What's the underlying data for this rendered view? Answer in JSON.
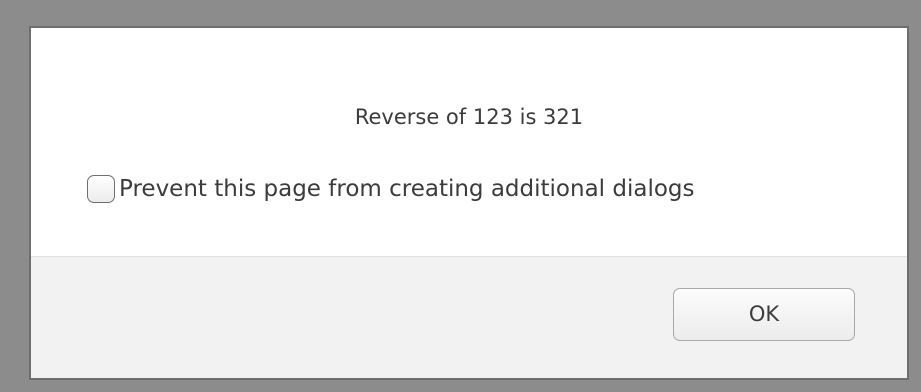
{
  "dialog": {
    "message": "Reverse of 123 is 321",
    "checkbox": {
      "label": "Prevent this page from creating additional dialogs",
      "checked": false
    },
    "ok_label": "OK"
  },
  "colors": {
    "backdrop": "#8c8c8c",
    "dialog_bg": "#ffffff",
    "footer_bg": "#f2f2f2",
    "text": "#3c3c3c"
  }
}
